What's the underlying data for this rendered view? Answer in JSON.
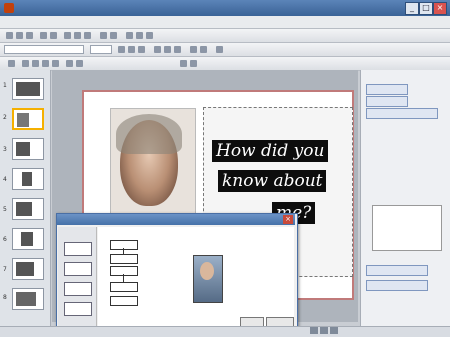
{
  "window": {
    "title": "",
    "minimize_glyph": "_",
    "maximize_glyph": "□",
    "close_glyph": "×"
  },
  "menubar": {
    "items": []
  },
  "format_toolbar": {
    "font": "",
    "size": ""
  },
  "slide": {
    "quote_lines": [
      "How did you",
      "know about",
      "me?"
    ]
  },
  "task_pane": {
    "title": ""
  },
  "dialog": {
    "title": "",
    "tabs": [],
    "ok_label": "",
    "cancel_label": ""
  },
  "status": {
    "text": ""
  },
  "colors": {
    "title_bar": "#4671a8",
    "slide_border": "#c07a7a",
    "quote_bg": "#0d0d0d",
    "selection": "#f5b000"
  },
  "icons": [
    "app-icon",
    "minimize-icon",
    "maximize-icon",
    "close-icon"
  ]
}
